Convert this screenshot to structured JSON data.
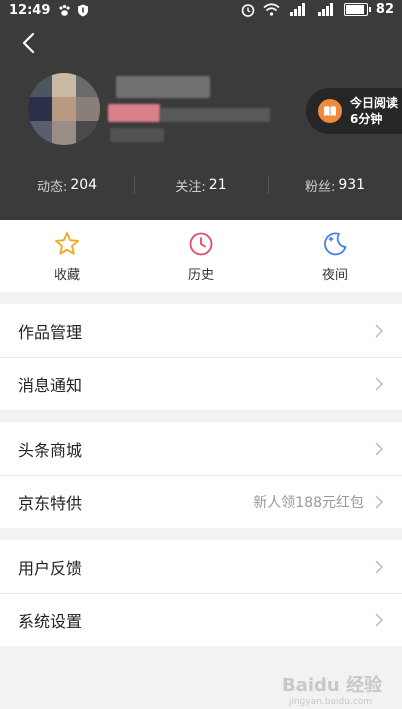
{
  "status_bar": {
    "time": "12:49",
    "battery": "82",
    "battery_level": 0.82
  },
  "profile": {
    "reading_badge": {
      "line1": "今日阅读",
      "line2": "6分钟"
    },
    "stats": [
      {
        "label": "动态:",
        "value": "204"
      },
      {
        "label": "关注:",
        "value": "21"
      },
      {
        "label": "粉丝:",
        "value": "931"
      }
    ]
  },
  "quick_actions": [
    {
      "label": "收藏",
      "icon": "star-icon",
      "color": "#f5a623"
    },
    {
      "label": "历史",
      "icon": "clock-icon",
      "color": "#e24a6a"
    },
    {
      "label": "夜间",
      "icon": "moon-icon",
      "color": "#4a7fe8"
    }
  ],
  "menu": {
    "group1": [
      {
        "label": "作品管理"
      },
      {
        "label": "消息通知"
      }
    ],
    "group2": [
      {
        "label": "头条商城"
      },
      {
        "label": "京东特供",
        "extra": "新人领188元红包"
      }
    ],
    "group3": [
      {
        "label": "用户反馈"
      },
      {
        "label": "系统设置"
      }
    ]
  },
  "watermark": {
    "text": "Baidu 经验",
    "sub": "jingyan.baidu.com"
  }
}
